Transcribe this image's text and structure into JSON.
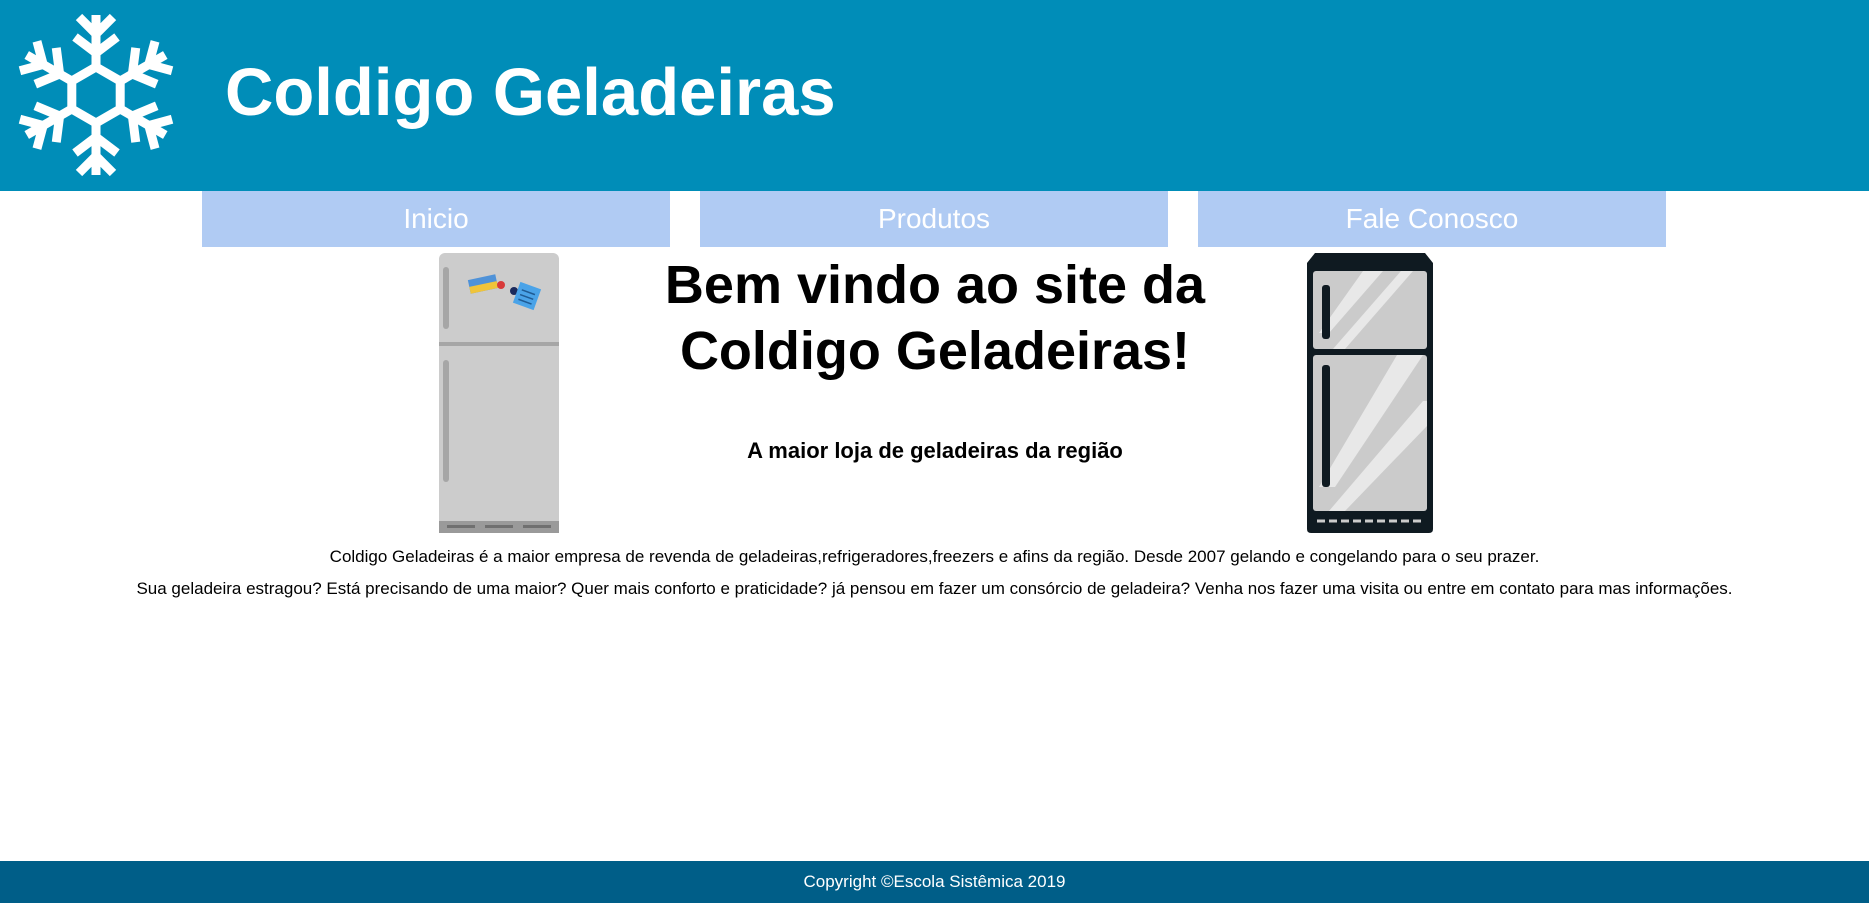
{
  "header": {
    "title": "Coldigo Geladeiras",
    "logo_icon": "snowflake-icon",
    "background_color": "#008db8"
  },
  "nav": {
    "items": [
      {
        "label": "Inicio"
      },
      {
        "label": "Produtos"
      },
      {
        "label": "Fale Conosco"
      }
    ],
    "background_color": "#b0cbf3"
  },
  "main": {
    "welcome": "Bem vindo ao site da Coldigo Geladeiras!",
    "tagline": "A maior loja de geladeiras da região",
    "left_image_icon": "fridge-icon",
    "right_image_icon": "fridge-icon",
    "paragraphs": [
      "Coldigo Geladeiras é a maior empresa de revenda de geladeiras,refrigeradores,freezers e afins da região. Desde 2007 gelando e congelando para o seu prazer.",
      "Sua geladeira estragou? Está precisando de uma maior? Quer mais conforto e praticidade? já pensou em fazer um consórcio de geladeira? Venha nos fazer uma visita ou entre em contato para mas informações."
    ]
  },
  "footer": {
    "copyright": "Copyright ©Escola Sistêmica 2019",
    "background_color": "#005e88"
  }
}
